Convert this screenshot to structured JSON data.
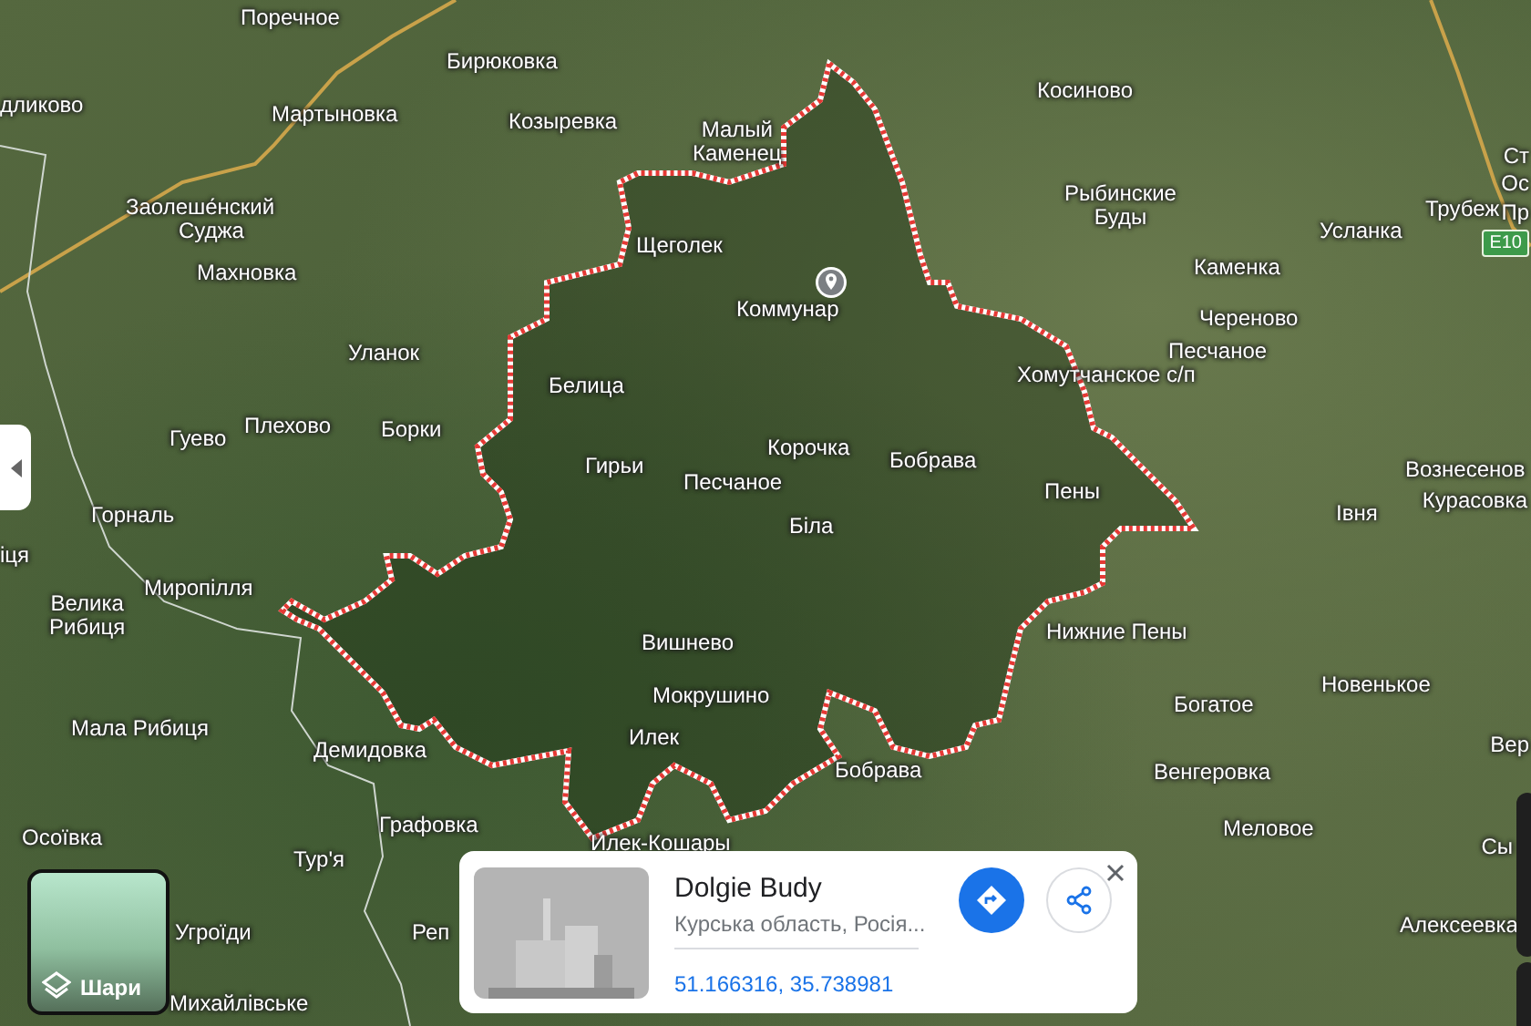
{
  "map": {
    "labels": [
      {
        "text": "Поречное"
      },
      {
        "text": "дликово"
      },
      {
        "text": "Бирюковка"
      },
      {
        "text": "Мартыновка"
      },
      {
        "text": "Козыревка"
      },
      {
        "text": "Малый\nКаменец"
      },
      {
        "text": "Заолеше́нский"
      },
      {
        "text": "Суджа"
      },
      {
        "text": "Махновка"
      },
      {
        "text": "Щеголек"
      },
      {
        "text": "Уланок"
      },
      {
        "text": "Белица"
      },
      {
        "text": "Гуево"
      },
      {
        "text": "Плехово"
      },
      {
        "text": "Борки"
      },
      {
        "text": "Гирьи"
      },
      {
        "text": "Песчаное"
      },
      {
        "text": "Корочка"
      },
      {
        "text": "Косиново"
      },
      {
        "text": "Рыбинские\nБуды"
      },
      {
        "text": "Усланка"
      },
      {
        "text": "Трубеж"
      },
      {
        "text": "Ст"
      },
      {
        "text": "Ос"
      },
      {
        "text": "Пр"
      },
      {
        "text": "Каменка"
      },
      {
        "text": "Череново"
      },
      {
        "text": "Песчаное"
      },
      {
        "text": "Хомутчанское с/п"
      },
      {
        "text": "Бобрава"
      },
      {
        "text": "Пены"
      },
      {
        "text": "Вознесенов"
      },
      {
        "text": "Курасовка"
      },
      {
        "text": "Горналь"
      },
      {
        "text": "іця"
      },
      {
        "text": "Миропілля"
      },
      {
        "text": "Велика\nРибиця"
      },
      {
        "text": "Мала Рибиця"
      },
      {
        "text": "Вишнево"
      },
      {
        "text": "Мокрушино"
      },
      {
        "text": "Илек"
      },
      {
        "text": "Демидовка"
      },
      {
        "text": "Осоївка"
      },
      {
        "text": "Графовка"
      },
      {
        "text": "Тур'я"
      },
      {
        "text": "Илек-Кошары"
      },
      {
        "text": "Угроїди"
      },
      {
        "text": "Реп"
      },
      {
        "text": "Михайлівське"
      },
      {
        "text": "Біла"
      },
      {
        "text": "Івня"
      },
      {
        "text": "Нижние Пены"
      },
      {
        "text": "Новенькое"
      },
      {
        "text": "Богатое"
      },
      {
        "text": "Бобрава"
      },
      {
        "text": "Венгеровка"
      },
      {
        "text": "Вер"
      },
      {
        "text": "Меловое"
      },
      {
        "text": "Сы"
      },
      {
        "text": "Алексеевка"
      }
    ],
    "pin": {
      "label": "Коммунар"
    },
    "route_badge": "E10"
  },
  "layers_button": {
    "label": "Шари"
  },
  "place_card": {
    "title": "Dolgie Budy",
    "subtitle": "Курська область, Росія...",
    "coordinates": "51.166316, 35.738981"
  }
}
